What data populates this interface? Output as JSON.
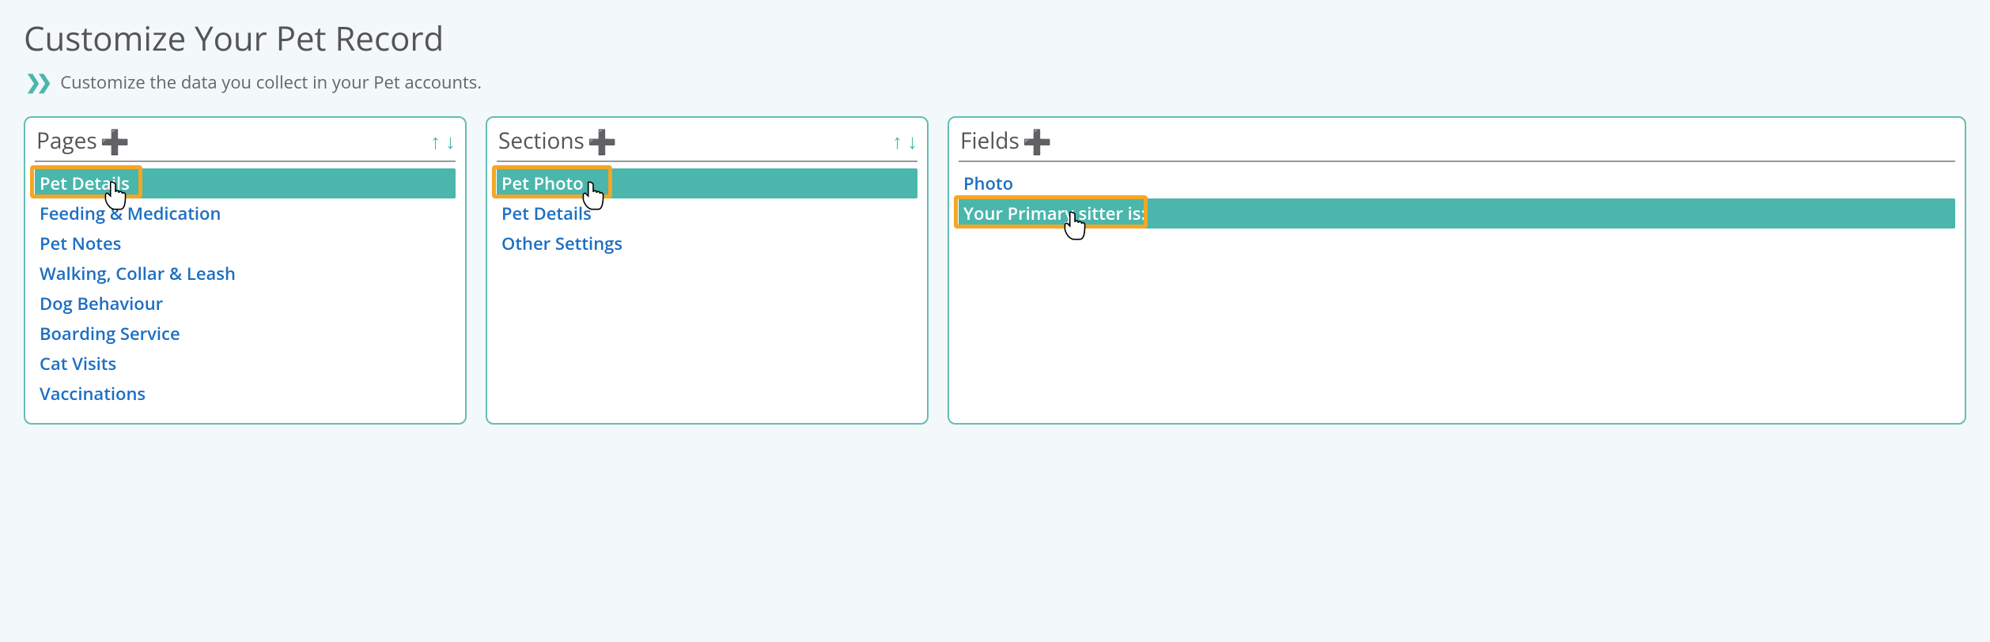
{
  "header": {
    "title": "Customize Your Pet Record",
    "subtitle": "Customize the data you collect in your Pet accounts."
  },
  "panels": {
    "pages": {
      "title": "Pages",
      "items": [
        "Pet Details",
        "Feeding & Medication",
        "Pet Notes",
        "Walking, Collar & Leash",
        "Dog Behaviour",
        "Boarding Service",
        "Cat Visits",
        "Vaccinations"
      ],
      "selectedIndex": 0
    },
    "sections": {
      "title": "Sections",
      "items": [
        "Pet Photo",
        "Pet Details",
        "Other Settings"
      ],
      "selectedIndex": 0
    },
    "fields": {
      "title": "Fields",
      "items": [
        "Photo",
        "Your Primary sitter is:"
      ],
      "selectedIndex": 1
    }
  }
}
